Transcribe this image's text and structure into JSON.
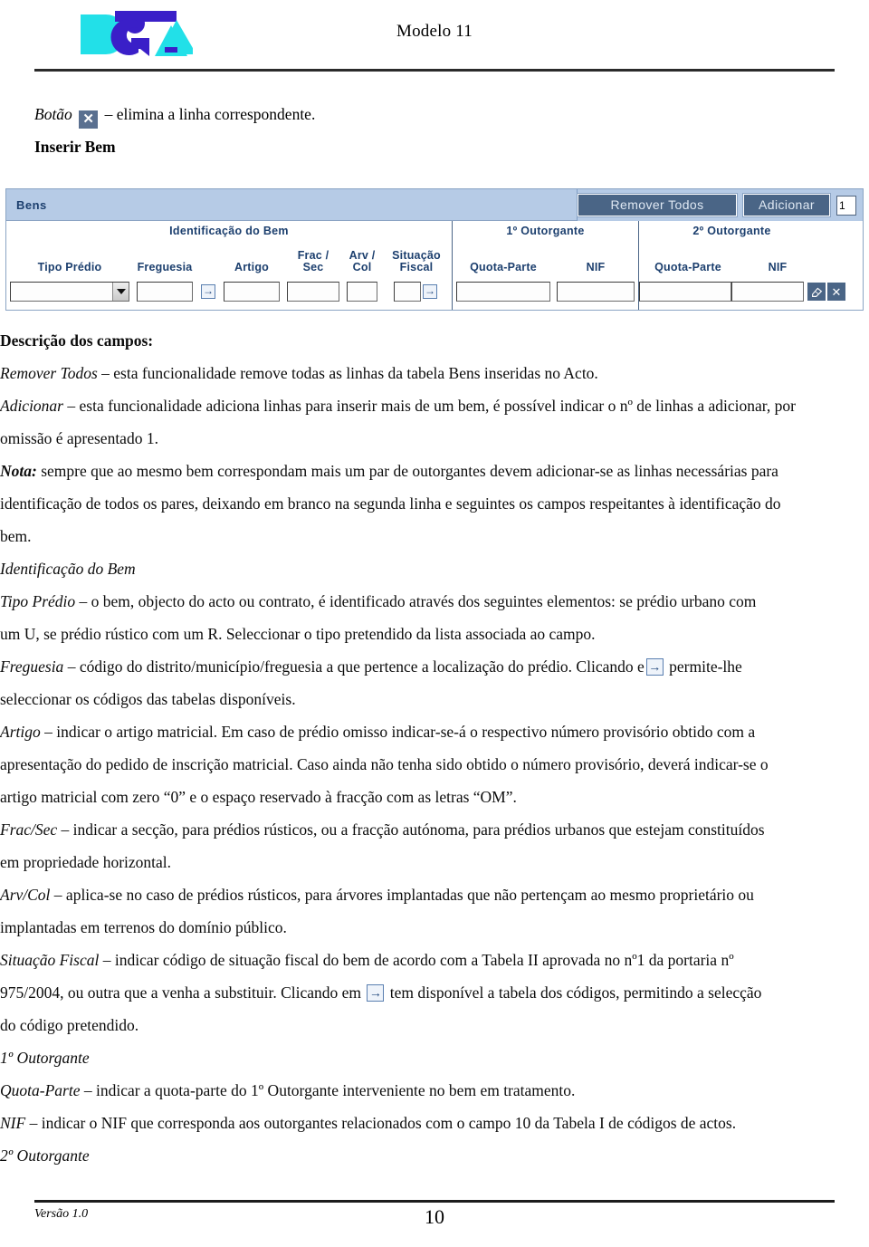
{
  "header": {
    "logo_alt": "DGCI logo",
    "title": "Modelo 11"
  },
  "intro": {
    "botao_label": "Botão",
    "x_icon": "close-icon",
    "botao_text": "– elimina a linha correspondente.",
    "subhead": "Inserir Bem"
  },
  "form": {
    "panel_title": "Bens",
    "remove_all_label": "Remover Todos",
    "add_label": "Adicionar",
    "add_qty_value": "1",
    "groups": {
      "bem_title": "Identificação do Bem",
      "out1_title": "1º Outorgante",
      "out2_title": "2º Outorgante"
    },
    "columns": {
      "tipo_predio": "Tipo Prédio",
      "freguesia": "Freguesia",
      "artigo": "Artigo",
      "frac_sec_l1": "Frac /",
      "frac_sec_l2": "Sec",
      "arv_col_l1": "Arv /",
      "arv_col_l2": "Col",
      "situacao_fiscal_l1": "Situação",
      "situacao_fiscal_l2": "Fiscal",
      "out1_quota": "Quota-Parte",
      "out1_nif": "NIF",
      "out2_quota": "Quota-Parte",
      "out2_nif": "NIF"
    },
    "values": {
      "tipo_predio": "",
      "freguesia": "",
      "artigo": "",
      "frac_sec": "",
      "arv_col": "",
      "situacao_fiscal": "",
      "out1_quota": "",
      "out1_nif": "",
      "out2_quota": "",
      "out2_nif": ""
    },
    "row_tools": {
      "clear_icon": "eraser-icon",
      "delete_icon": "close-icon"
    },
    "colors": {
      "titlebar_bg": "#b6cbe6",
      "button_bg": "#4a6586",
      "header_text": "#1c3f6e"
    }
  },
  "content": {
    "descricao_heading": "Descrição dos campos:",
    "remover_todos": {
      "term": "Remover Todos",
      "text": " – esta funcionalidade remove todas as linhas da tabela Bens inseridas no Acto."
    },
    "adicionar": {
      "term": "Adicionar",
      "text": " – esta funcionalidade adiciona linhas para inserir mais de um bem, é possível indicar o nº de linhas a adicionar, por omissão é apresentado 1."
    },
    "nota": {
      "term": "Nota:",
      "text": " sempre que ao mesmo bem correspondam mais um par de outorgantes devem adicionar-se as linhas necessárias para identificação de todos os pares, deixando em branco na segunda linha e seguintes os campos respeitantes à identificação do bem."
    },
    "identificacao_heading": "Identificação do Bem",
    "tipo_predio": {
      "term": "Tipo Prédio",
      "text": " – o bem, objecto do acto ou contrato, é identificado através dos seguintes elementos: se prédio urbano com um U, se prédio rústico com um R. Seleccionar o tipo pretendido da lista associada ao campo."
    },
    "freguesia": {
      "term": "Freguesia",
      "text_a": " – código do distrito/município/freguesia a que pertence a localização do prédio. Clicando e",
      "icon": "lookup-arrow-icon",
      "text_b": "permite-lhe seleccionar os códigos das tabelas disponíveis."
    },
    "artigo": {
      "term": "Artigo",
      "text": " – indicar o artigo matricial. Em caso de prédio omisso indicar-se-á o respectivo número provisório obtido com a apresentação do pedido de inscrição matricial. Caso ainda não tenha sido obtido o número provisório, deverá indicar-se o artigo matricial com zero “0” e o espaço reservado à fracção com as letras “OM”."
    },
    "frac_sec": {
      "term": "Frac/Sec",
      "text": " – indicar a secção, para prédios rústicos, ou a fracção autónoma, para prédios urbanos que estejam constituídos em propriedade horizontal."
    },
    "arv_col": {
      "term": "Arv/Col",
      "text": " – aplica-se no caso de prédios rústicos, para árvores implantadas que não pertençam ao mesmo proprietário ou implantadas em terrenos do domínio público."
    },
    "situacao_fiscal": {
      "term": "Situação Fiscal",
      "text_a": " – indicar código de situação fiscal do bem de acordo com a Tabela II aprovada no nº1 da portaria nº 975/2004, ou outra que a venha a substituir. Clicando em ",
      "icon": "lookup-arrow-icon",
      "text_b": " tem disponível a tabela dos códigos, permitindo a selecção do código pretendido."
    },
    "outorgante1_heading": "1º Outorgante",
    "quota_parte": {
      "term": "Quota-Parte",
      "text": " – indicar a quota-parte do 1º Outorgante interveniente no bem em tratamento."
    },
    "nif": {
      "term": "NIF",
      "text": " – indicar o NIF que corresponda aos outorgantes relacionados com o campo 10 da Tabela I de códigos de actos."
    },
    "outorgante2_heading": "2º Outorgante"
  },
  "footer": {
    "version": "Versão 1.0",
    "page_number": "10"
  }
}
